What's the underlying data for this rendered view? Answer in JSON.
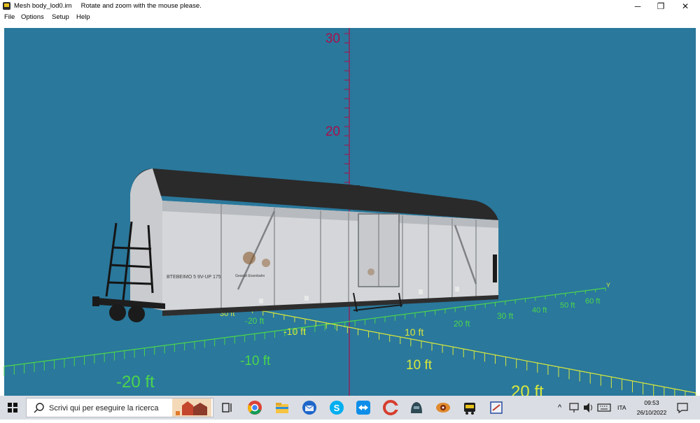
{
  "window": {
    "title": "Mesh body_lod0.im",
    "hint": "Rotate and zoom with the mouse please.",
    "controls": {
      "minimize": "─",
      "restore": "❐",
      "close": "✕"
    }
  },
  "menu": [
    "File",
    "Options",
    "Setup",
    "Help"
  ],
  "viewport": {
    "background": "#2a789c",
    "vertical_axis": {
      "color": "#a8104a",
      "labels": [
        "30",
        "20"
      ]
    },
    "x_axis": {
      "color": "#4cd64c",
      "labels": [
        "-20 ft",
        "-10 ft",
        "10 ft",
        "20 ft",
        "30 ft"
      ]
    },
    "y_axis": {
      "color": "#d8e83c",
      "axis_label": "Y",
      "labels": [
        "-20 ft",
        "-10 ft",
        "10 ft",
        "20 ft",
        "30 ft",
        "40 ft",
        "50 ft",
        "60 ft"
      ]
    },
    "far_labels": {
      "left": "-20 ft",
      "center": "-10 ft",
      "right": "10 ft",
      "bottom_right": "20 ft"
    },
    "model": "boxcar",
    "markings": [
      "BTEBEIMO 5 9V-UP 175",
      "Gesetzt Eisenbahn"
    ]
  },
  "taskbar": {
    "search_placeholder": "Scrivi qui per eseguire la ricerca",
    "language": "ITA",
    "time": "09:53",
    "date": "26/10/2022",
    "pinned": [
      "task-view-icon",
      "chrome-icon",
      "file-explorer-icon",
      "thunderbird-icon",
      "skype-icon",
      "teamviewer-icon",
      "ccleaner-icon",
      "game-icon",
      "eye-app-icon",
      "train-app-icon",
      "settings-app-icon"
    ]
  }
}
